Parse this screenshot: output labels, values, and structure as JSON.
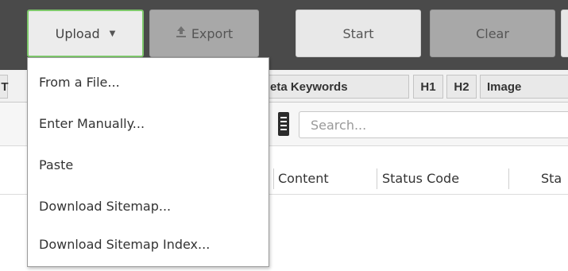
{
  "toolbar": {
    "upload_label": "Upload",
    "upload_caret": "▼",
    "export_label": "Export",
    "export_icon": "upload-arrow-icon",
    "start_label": "Start",
    "clear_label": "Clear"
  },
  "tabs": {
    "partial_left": "T",
    "items": [
      "eta Keywords",
      "H1",
      "H2",
      "Image"
    ]
  },
  "search": {
    "placeholder": "Search..."
  },
  "columns": [
    "Content",
    "Status Code",
    "Sta"
  ],
  "menu": {
    "items": [
      "From a File...",
      "Enter Manually...",
      "Paste",
      "Download Sitemap...",
      "Download Sitemap Index..."
    ]
  },
  "colors": {
    "toolbar_bg": "#4a4a4a",
    "upload_border": "#7ec86b",
    "disabled_button": "#a8a8a8"
  }
}
